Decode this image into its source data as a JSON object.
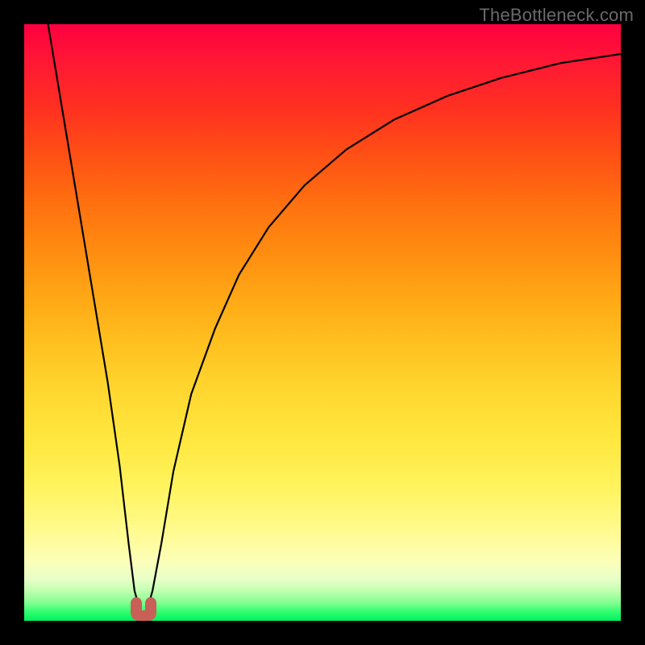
{
  "watermark": "TheBottleneck.com",
  "chart_data": {
    "type": "line",
    "title": "",
    "xlabel": "",
    "ylabel": "",
    "xlim": [
      0,
      100
    ],
    "ylim": [
      0,
      100
    ],
    "series": [
      {
        "name": "curve",
        "x": [
          4,
          6,
          8,
          10,
          12,
          14,
          16,
          17.5,
          18.5,
          19.5,
          20.5,
          21.5,
          23,
          25,
          28,
          32,
          36,
          41,
          47,
          54,
          62,
          71,
          80,
          90,
          100
        ],
        "y": [
          100,
          88,
          76,
          64,
          52,
          40,
          26,
          13,
          5,
          1.5,
          1.5,
          5,
          13,
          25,
          38,
          49,
          58,
          66,
          73,
          79,
          84,
          88,
          91,
          93.5,
          95
        ]
      }
    ],
    "marker": {
      "x": 20,
      "y_min": 0,
      "y_max": 3,
      "color": "#c86058"
    },
    "gradient_stops": [
      {
        "pct": 0,
        "color": "#ff0040"
      },
      {
        "pct": 50,
        "color": "#ffc000"
      },
      {
        "pct": 90,
        "color": "#ffff80"
      },
      {
        "pct": 100,
        "color": "#00f060"
      }
    ]
  }
}
